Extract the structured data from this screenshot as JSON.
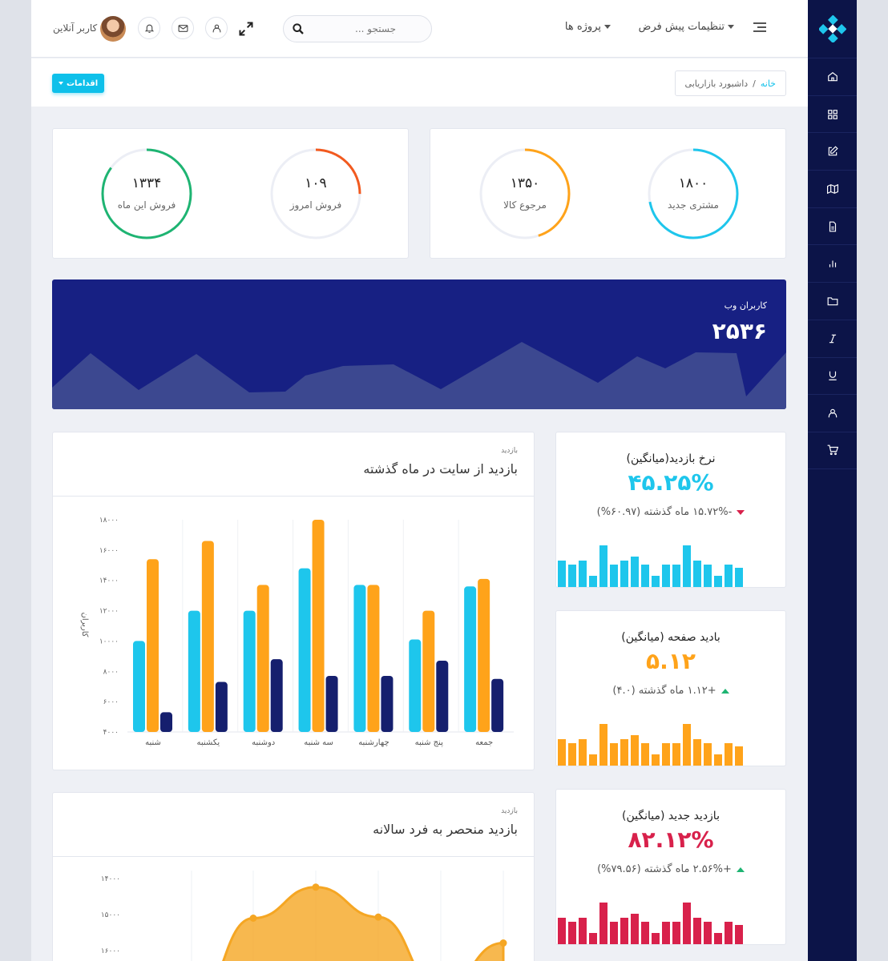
{
  "header": {
    "menu_settings": "تنظیمات پیش فرض",
    "menu_projects": "پروژه ها",
    "search_placeholder": "جستجو ...",
    "user_name": "کاربر آنلاین"
  },
  "subbar": {
    "actions_button": "اقدامات",
    "breadcrumb_home": "خانه",
    "breadcrumb_sep": "/",
    "breadcrumb_current": "داشبورد بازاریابی"
  },
  "sidebar": {
    "icons": [
      "home-icon",
      "grid-icon",
      "edit-icon",
      "map-icon",
      "file-icon",
      "bar-chart-icon",
      "folder-icon",
      "italic-icon",
      "underline-icon",
      "user-icon",
      "cart-icon"
    ]
  },
  "rings": [
    {
      "value": "۱۸۰۰",
      "label": "مشتری جدید",
      "color": "#1ec6ec",
      "fraction": 0.72
    },
    {
      "value": "۱۳۵۰",
      "label": "مرجوع کالا",
      "color": "#ffa31a",
      "fraction": 0.45
    },
    {
      "value": "۱۰۹",
      "label": "فروش امروز",
      "color": "#f25a1f",
      "fraction": 0.25
    },
    {
      "value": "۱۳۳۴",
      "label": "فروش این ماه",
      "color": "#1eb472",
      "fraction": 0.85
    }
  ],
  "web_users": {
    "title": "کاربران وب",
    "value": "۲۵۳۶"
  },
  "visits_chart": {
    "small": "بازدید",
    "title": "بازدید از سایت در ماه گذشته"
  },
  "yearly_chart": {
    "small": "بازدید",
    "title": "بازدید منحصر به فرد سالانه"
  },
  "stats": [
    {
      "title": "نرخ بازدید(میانگین)",
      "value": "۴۵.۲۵%",
      "color": "#1ec6ec",
      "change": "-۱۵.۷۲% ماه گذشته (۶۰.۹۷%)",
      "trend": "down"
    },
    {
      "title": "بادید صفحه (میانگین)",
      "value": "۵.۱۲",
      "color": "#ffa31a",
      "change": "+۱.۱۲ ماه گذشته (۴.۰)",
      "trend": "up"
    },
    {
      "title": "بازدید جدید (میانگین)",
      "value": "۸۲.۱۲%",
      "color": "#d8214b",
      "change": "+۲.۵۶% ماه گذشته (۷۹.۵۶%)",
      "trend": "up"
    }
  ],
  "chart_data": [
    {
      "type": "bar",
      "categories": [
        "شنبه",
        "یکشنبه",
        "دوشنبه",
        "سه شنبه",
        "چهارشنبه",
        "پنج شنبه",
        "جمعه"
      ],
      "series": [
        {
          "values": [
            10000,
            12000,
            12000,
            14800,
            13700,
            10100,
            13600
          ],
          "color": "#1ec6ec"
        },
        {
          "values": [
            15400,
            16600,
            13700,
            18000,
            13700,
            12000,
            14100
          ],
          "color": "#ffa31a"
        },
        {
          "values": [
            5300,
            7300,
            8800,
            7700,
            7700,
            8700,
            7500
          ],
          "color": "#151f6e"
        }
      ],
      "ylabel": "کاربران",
      "ylim": [
        4000,
        18000
      ],
      "yticks": [
        "۴۰۰۰",
        "۶۰۰۰",
        "۸۰۰۰",
        "۱۰۰۰۰",
        "۱۲۰۰۰",
        "۱۴۰۰۰",
        "۱۶۰۰۰",
        "۱۸۰۰۰"
      ],
      "grid": true
    },
    {
      "type": "area",
      "yticks": [
        "۱۴۰۰۰",
        "۱۵۰۰۰",
        "۱۶۰۰۰"
      ],
      "ylim": [
        14000,
        16000
      ],
      "x": [
        0,
        1,
        2,
        3,
        4,
        5
      ],
      "values": [
        12500,
        14900,
        15760,
        14930,
        12900,
        14210
      ],
      "color": "#f5a623"
    }
  ],
  "spark": {
    "cyan": [
      7,
      6,
      7,
      3,
      11,
      6,
      7,
      8,
      6,
      3,
      6,
      6,
      11,
      7,
      6,
      3,
      6,
      5
    ],
    "orange": [
      7,
      6,
      7,
      3,
      11,
      6,
      7,
      8,
      6,
      3,
      6,
      6,
      11,
      7,
      6,
      3,
      6,
      5
    ],
    "red": [
      7,
      6,
      7,
      3,
      11,
      6,
      7,
      8,
      6,
      3,
      6,
      6,
      11,
      7,
      6,
      3,
      6,
      5
    ]
  }
}
